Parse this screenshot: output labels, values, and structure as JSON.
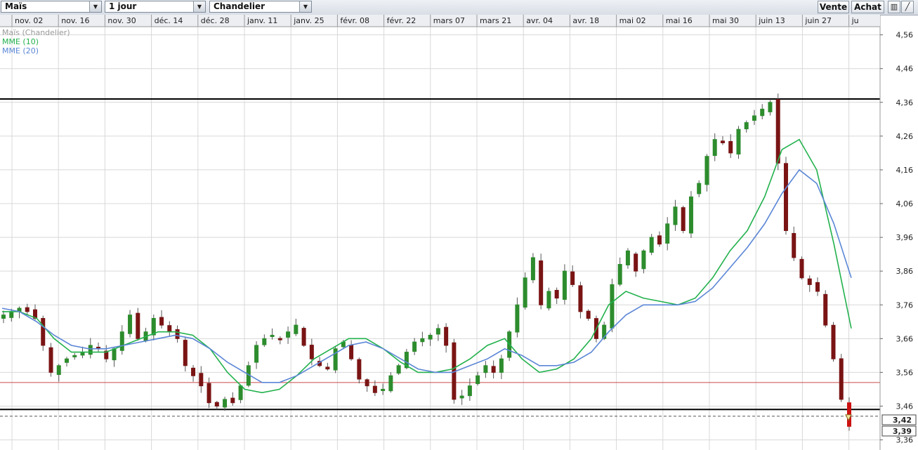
{
  "toolbar": {
    "instrument": "Maïs",
    "period": "1 jour",
    "chart_type": "Chandelier",
    "sell_label": "Vente",
    "buy_label": "Achat"
  },
  "legend": {
    "main": "Maïs (Chandelier)",
    "ema10": "MME (10)",
    "ema20": "MME (20)",
    "ema10_color": "#22b14c",
    "ema20_color": "#5b86d6"
  },
  "colors": {
    "bull": "#2d8c2d",
    "bear": "#7a1414",
    "last_bar": "#cc1111",
    "hline": "#000000",
    "support_line": "#c94a4a",
    "grid": "#d8d8d8"
  },
  "price_tags": {
    "current_label": "3,42",
    "low_label": "3,39"
  },
  "chart_data": {
    "type": "candlestick",
    "title": "Maïs (Chandelier)",
    "x_labels": [
      "nov. 02",
      "nov. 16",
      "nov. 30",
      "déc. 14",
      "déc. 28",
      "janv. 11",
      "janv. 25",
      "févr. 08",
      "févr. 22",
      "mars 07",
      "mars 21",
      "avr. 04",
      "avr. 18",
      "mai 02",
      "mai 16",
      "mai 30",
      "juin 13",
      "juin 27",
      "ju"
    ],
    "y_ticks": [
      "4,56",
      "4,46",
      "4,36",
      "4,26",
      "4,16",
      "4,06",
      "3,96",
      "3,86",
      "3,76",
      "3,66",
      "3,56",
      "3,46",
      "3,36"
    ],
    "ylim": [
      3.33,
      4.58
    ],
    "grid": true,
    "legend_position": "top-left",
    "horizontal_lines": [
      {
        "value": 4.37,
        "style": "solid-black"
      },
      {
        "value": 3.45,
        "style": "solid-black"
      },
      {
        "value": 3.53,
        "style": "solid-red"
      },
      {
        "value": 3.43,
        "style": "dashed"
      }
    ],
    "current_price": 3.42,
    "low_price": 3.39,
    "anchor_closes": [
      3.73,
      3.74,
      3.75,
      3.74,
      3.72,
      3.64,
      3.56,
      3.58,
      3.6,
      3.61,
      3.62,
      3.64,
      3.63,
      3.6,
      3.63,
      3.68,
      3.73,
      3.66,
      3.68,
      3.72,
      3.7,
      3.68,
      3.66,
      3.58,
      3.55,
      3.52,
      3.47,
      3.46,
      3.48,
      3.47,
      3.52,
      3.58,
      3.64,
      3.66,
      3.67,
      3.66,
      3.68,
      3.7,
      3.64,
      3.6,
      3.58,
      3.57,
      3.63,
      3.65,
      3.6,
      3.54,
      3.52,
      3.5,
      3.51,
      3.55,
      3.58,
      3.62,
      3.65,
      3.66,
      3.67,
      3.69,
      3.64,
      3.48,
      3.49,
      3.52,
      3.55,
      3.58,
      3.56,
      3.6,
      3.68,
      3.76,
      3.84,
      3.9,
      3.76,
      3.8,
      3.78,
      3.86,
      3.82,
      3.74,
      3.72,
      3.66,
      3.7,
      3.82,
      3.88,
      3.92,
      3.86,
      3.92,
      3.96,
      3.94,
      4.0,
      4.05,
      3.98,
      4.08,
      4.12,
      4.2,
      4.25,
      4.24,
      4.21,
      4.28,
      4.3,
      4.32,
      4.34,
      4.36,
      4.18,
      3.98,
      3.9,
      3.84,
      3.82,
      3.8,
      3.7,
      3.6,
      3.48,
      3.4
    ],
    "series": [
      {
        "name": "MME (10)",
        "values": [
          3.74,
          3.74,
          3.72,
          3.66,
          3.62,
          3.62,
          3.62,
          3.64,
          3.66,
          3.68,
          3.68,
          3.67,
          3.63,
          3.56,
          3.51,
          3.5,
          3.51,
          3.55,
          3.6,
          3.63,
          3.66,
          3.66,
          3.63,
          3.59,
          3.56,
          3.56,
          3.57,
          3.6,
          3.64,
          3.66,
          3.6,
          3.56,
          3.57,
          3.6,
          3.66,
          3.76,
          3.8,
          3.78,
          3.77,
          3.76,
          3.78,
          3.84,
          3.92,
          3.98,
          4.08,
          4.22,
          4.25,
          4.16,
          3.94,
          3.69
        ]
      },
      {
        "name": "MME (20)",
        "values": [
          3.75,
          3.74,
          3.71,
          3.67,
          3.64,
          3.63,
          3.63,
          3.64,
          3.65,
          3.66,
          3.67,
          3.66,
          3.63,
          3.59,
          3.56,
          3.53,
          3.53,
          3.55,
          3.58,
          3.61,
          3.64,
          3.65,
          3.63,
          3.6,
          3.57,
          3.56,
          3.56,
          3.58,
          3.6,
          3.63,
          3.61,
          3.58,
          3.58,
          3.59,
          3.62,
          3.68,
          3.73,
          3.76,
          3.76,
          3.76,
          3.77,
          3.81,
          3.87,
          3.93,
          4.0,
          4.09,
          4.16,
          4.12,
          4.0,
          3.84
        ]
      }
    ]
  }
}
